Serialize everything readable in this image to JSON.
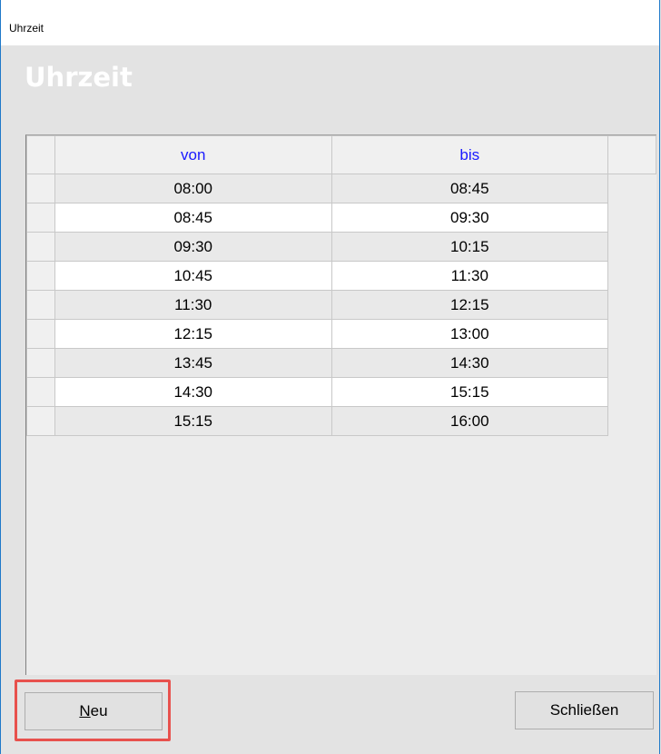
{
  "window": {
    "title": "Uhrzeit"
  },
  "header": {
    "title": "Uhrzeit"
  },
  "grid": {
    "columns": [
      "von",
      "bis"
    ],
    "rows": [
      [
        "08:00",
        "08:45"
      ],
      [
        "08:45",
        "09:30"
      ],
      [
        "09:30",
        "10:15"
      ],
      [
        "10:45",
        "11:30"
      ],
      [
        "11:30",
        "12:15"
      ],
      [
        "12:15",
        "13:00"
      ],
      [
        "13:45",
        "14:30"
      ],
      [
        "14:30",
        "15:15"
      ],
      [
        "15:15",
        "16:00"
      ]
    ]
  },
  "buttons": {
    "new_prefix": "N",
    "new_rest": "eu",
    "close_label": "Schließen"
  },
  "colors": {
    "header_text": "#1a1aff",
    "highlight": "#e8514d",
    "window_border": "#1f79c9"
  }
}
